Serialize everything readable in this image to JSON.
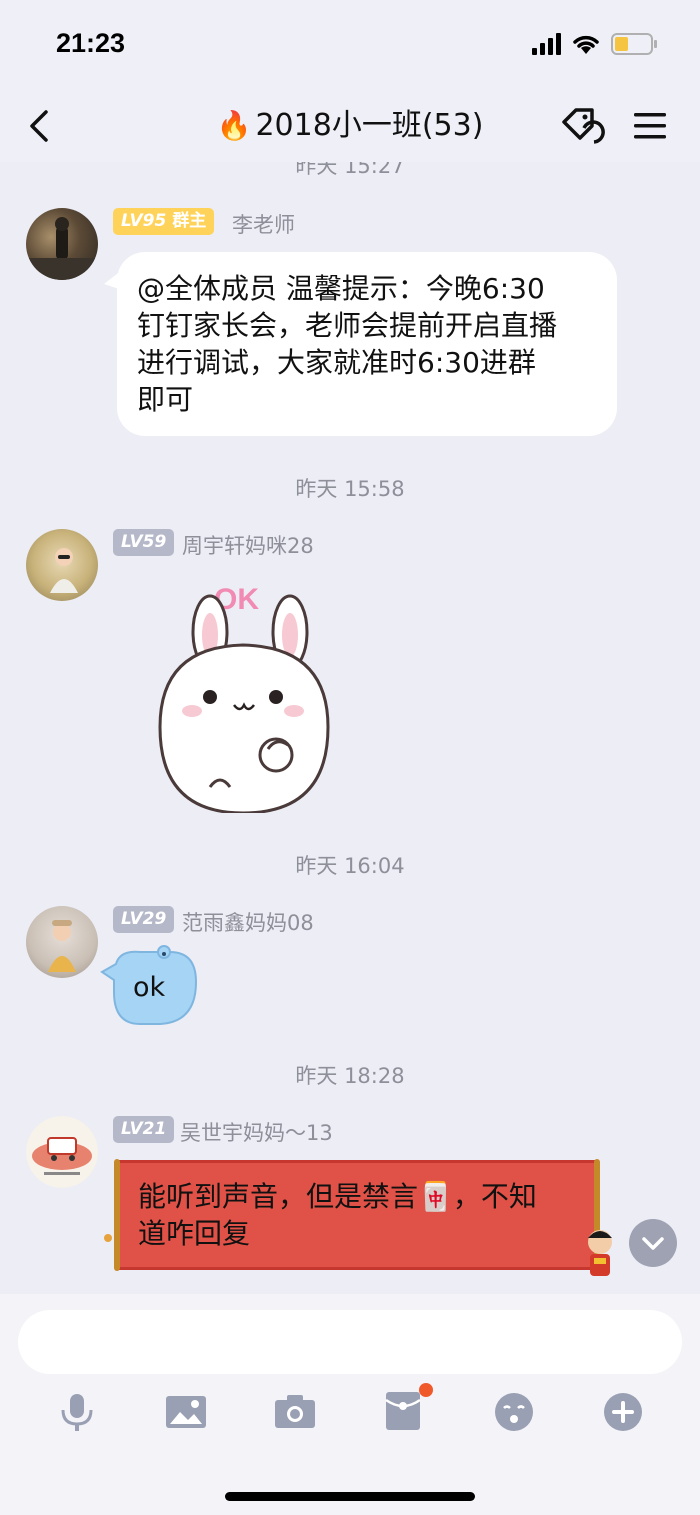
{
  "status_bar": {
    "time": "21:23",
    "icons": [
      "signal-icon",
      "wifi-icon",
      "battery-icon"
    ]
  },
  "nav": {
    "title": "2018小一班(53)",
    "icons": [
      "back-icon",
      "fire-icon",
      "tag-icon",
      "menu-icon"
    ]
  },
  "chat": {
    "partial_timestamp": "昨天 15:27",
    "messages": [
      {
        "timestamp": null,
        "level": "LV95",
        "role": "群主",
        "sender": "李老师",
        "text": "@全体成员 温馨提示：今晚6:30钉钉家长会，老师会提前开启直播进行调试，大家就准时6:30进群即可",
        "lines": [
          "@全体成员 温馨提示：今晚6:30",
          "钉钉家长会，老师会提前开启直播",
          "进行调试，大家就准时6:30进群",
          "即可"
        ]
      },
      {
        "timestamp": "昨天 15:58",
        "level": "LV59",
        "sender": "周宇轩妈咪28",
        "sticker": "ok-bunny-sticker",
        "sticker_text": "OK"
      },
      {
        "timestamp": "昨天 16:04",
        "level": "LV29",
        "sender": "范雨鑫妈妈08",
        "text": "ok"
      },
      {
        "timestamp": "昨天 18:28",
        "level": "LV21",
        "sender": "吴世宇妈妈～13",
        "text": "能听到声音，但是禁言🀄，不知道咋回复",
        "lines": [
          "能听到声音，但是禁言🀄，不知",
          "道咋回复"
        ]
      }
    ]
  },
  "input": {
    "placeholder": "",
    "value": ""
  },
  "toolbar": {
    "icons": [
      "microphone-icon",
      "image-icon",
      "camera-icon",
      "red-packet-icon",
      "emoji-icon",
      "plus-icon"
    ],
    "notification_dot_color": "#f05a2a"
  },
  "colors": {
    "background": "#ecedf5",
    "bubble": "#ffffff",
    "owner_badge": "#ffd35a",
    "member_badge": "#b5b8c8",
    "red_bubble": "#e05247",
    "blue_bubble": "#a6d4f5"
  }
}
